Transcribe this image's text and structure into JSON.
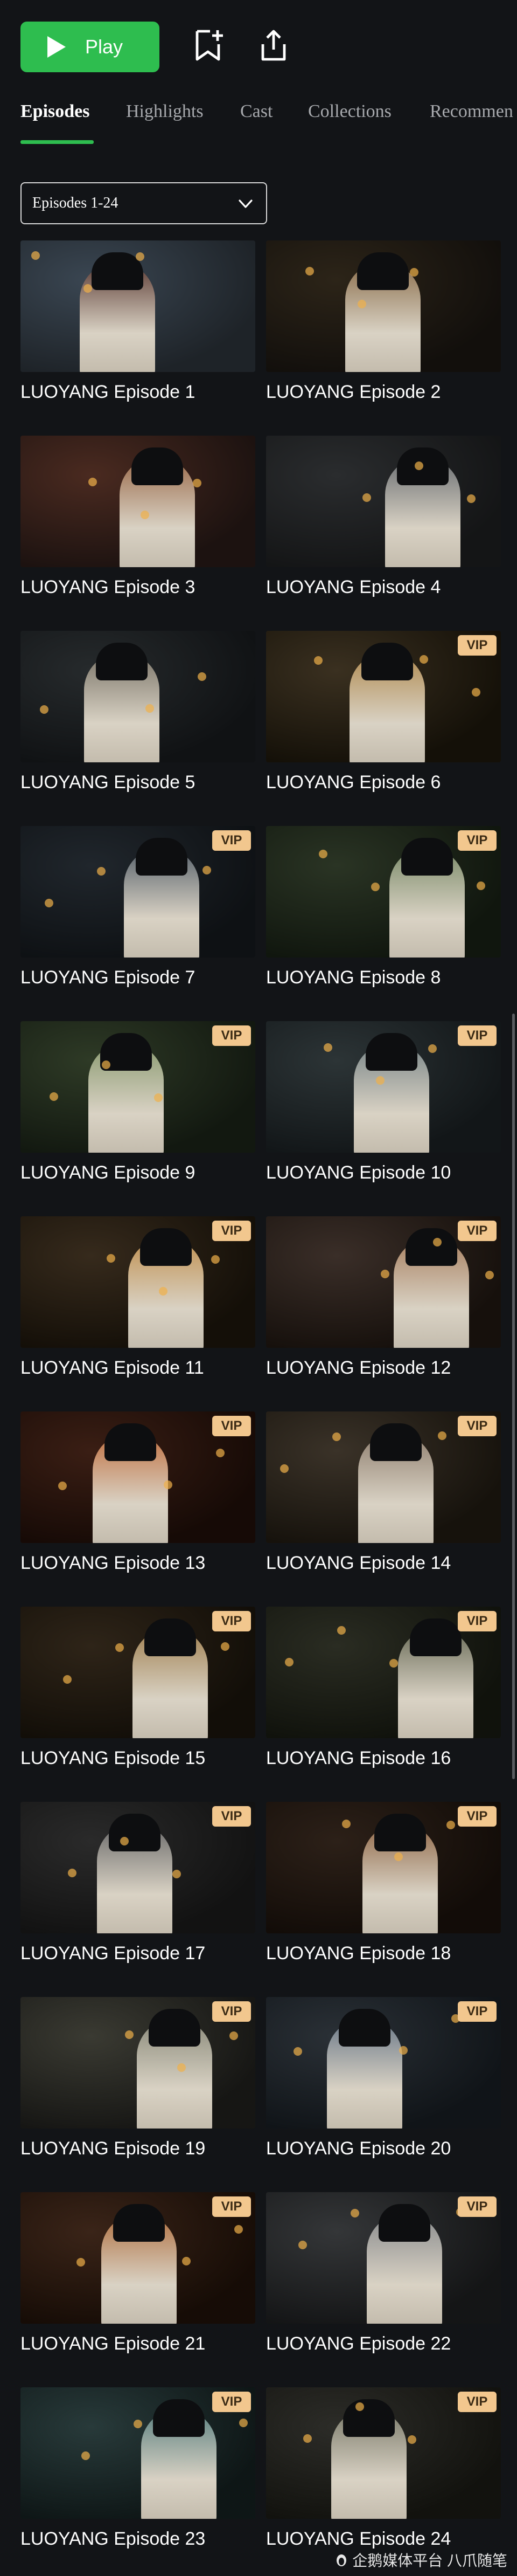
{
  "toolbar": {
    "play_label": "Play",
    "bookmark_icon": "bookmark-add-icon",
    "share_icon": "share-icon",
    "accent_color": "#2ebd4f"
  },
  "tabs": [
    {
      "label": "Episodes",
      "active": true
    },
    {
      "label": "Highlights",
      "active": false
    },
    {
      "label": "Cast",
      "active": false
    },
    {
      "label": "Collections",
      "active": false
    },
    {
      "label": "Recommen",
      "active": false
    }
  ],
  "selector": {
    "label": "Episodes 1-24",
    "icon": "chevron-down-icon"
  },
  "episodes": [
    {
      "title": "LUOYANG Episode 1",
      "vip": false
    },
    {
      "title": "LUOYANG Episode 2",
      "vip": false
    },
    {
      "title": "LUOYANG Episode 3",
      "vip": false
    },
    {
      "title": "LUOYANG Episode 4",
      "vip": false
    },
    {
      "title": "LUOYANG Episode 5",
      "vip": false
    },
    {
      "title": "LUOYANG Episode 6",
      "vip": true
    },
    {
      "title": "LUOYANG Episode 7",
      "vip": true
    },
    {
      "title": "LUOYANG Episode 8",
      "vip": true
    },
    {
      "title": "LUOYANG Episode 9",
      "vip": true
    },
    {
      "title": "LUOYANG Episode 10",
      "vip": true
    },
    {
      "title": "LUOYANG Episode 11",
      "vip": true
    },
    {
      "title": "LUOYANG Episode 12",
      "vip": true
    },
    {
      "title": "LUOYANG Episode 13",
      "vip": true
    },
    {
      "title": "LUOYANG Episode 14",
      "vip": true
    },
    {
      "title": "LUOYANG Episode 15",
      "vip": true
    },
    {
      "title": "LUOYANG Episode 16",
      "vip": true
    },
    {
      "title": "LUOYANG Episode 17",
      "vip": true
    },
    {
      "title": "LUOYANG Episode 18",
      "vip": true
    },
    {
      "title": "LUOYANG Episode 19",
      "vip": true
    },
    {
      "title": "LUOYANG Episode 20",
      "vip": true
    },
    {
      "title": "LUOYANG Episode 21",
      "vip": true
    },
    {
      "title": "LUOYANG Episode 22",
      "vip": true
    },
    {
      "title": "LUOYANG Episode 23",
      "vip": true
    },
    {
      "title": "LUOYANG Episode 24",
      "vip": true
    }
  ],
  "vip_label": "VIP",
  "vip_color": "#f2c78e",
  "watermark": "企鹅媒体平台 八爪随笔"
}
